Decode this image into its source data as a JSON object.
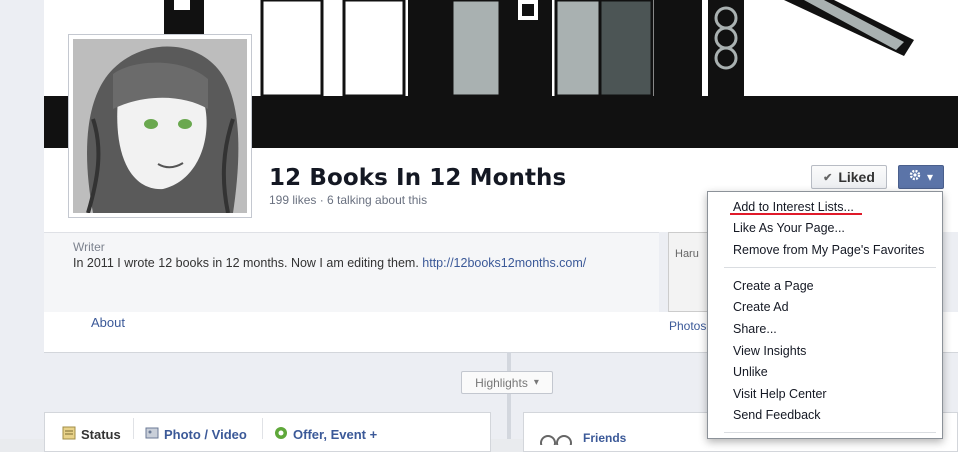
{
  "page": {
    "name": "12 Books In 12 Months",
    "stats": "199 likes · 6 talking about this"
  },
  "actions": {
    "liked_label": "Liked",
    "check_icon": "✔",
    "gear_icon": "gear-icon",
    "caret_icon": "▾"
  },
  "about": {
    "category": "Writer",
    "description": "In 2011 I wrote 12 books in 12 months. Now I am editing them.",
    "url": "http://12books12months.com/",
    "link_label": "About"
  },
  "photos": {
    "label": "Photos",
    "thumb_text": "Haru"
  },
  "timeline": {
    "highlights_label": "Highlights",
    "caret": "▾"
  },
  "composer": {
    "tabs": [
      {
        "label": "Status"
      },
      {
        "label": "Photo / Video"
      },
      {
        "label": "Offer, Event +"
      }
    ]
  },
  "friends": {
    "label": "Friends"
  },
  "menu": {
    "items": [
      {
        "label": "Add to Interest Lists..."
      },
      {
        "label": "Like As Your Page..."
      },
      {
        "label": "Remove from My Page's Favorites"
      },
      {
        "label": "Create a Page"
      },
      {
        "label": "Create Ad"
      },
      {
        "label": "Share..."
      },
      {
        "label": "View Insights"
      },
      {
        "label": "Unlike"
      },
      {
        "label": "Visit Help Center"
      },
      {
        "label": "Send Feedback"
      }
    ]
  },
  "colors": {
    "link": "#3b5998",
    "highlight_underline": "#e01a2a",
    "gear_button": "#5b74a8"
  }
}
